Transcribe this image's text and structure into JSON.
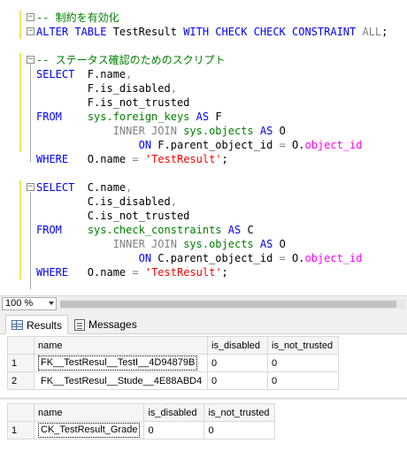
{
  "editor": {
    "lines": [
      [
        {
          "t": "-- 制約を有効化",
          "c": "cm"
        }
      ],
      [
        {
          "t": "ALTER TABLE ",
          "c": "kw"
        },
        {
          "t": "TestResult ",
          "c": "plain"
        },
        {
          "t": "WITH CHECK CHECK CONSTRAINT ",
          "c": "kw"
        },
        {
          "t": "ALL",
          "c": "gr"
        },
        {
          "t": ";",
          "c": "plain"
        }
      ],
      [
        {
          "t": "",
          "c": "plain"
        }
      ],
      [
        {
          "t": "-- ステータス確認のためのスクリプト",
          "c": "cm"
        }
      ],
      [
        {
          "t": "SELECT",
          "c": "kw"
        },
        {
          "t": "  F.name",
          "c": "plain"
        },
        {
          "t": ",",
          "c": "gr"
        }
      ],
      [
        {
          "t": "        F.is_disabled",
          "c": "plain"
        },
        {
          "t": ",",
          "c": "gr"
        }
      ],
      [
        {
          "t": "        F.is_not_trusted",
          "c": "plain"
        }
      ],
      [
        {
          "t": "FROM",
          "c": "kw"
        },
        {
          "t": "    ",
          "c": "plain"
        },
        {
          "t": "sys.foreign_keys",
          "c": "sys"
        },
        {
          "t": " AS ",
          "c": "kw"
        },
        {
          "t": "F",
          "c": "plain"
        }
      ],
      [
        {
          "t": "            ",
          "c": "plain"
        },
        {
          "t": "INNER JOIN",
          "c": "gr"
        },
        {
          "t": " ",
          "c": "plain"
        },
        {
          "t": "sys.objects",
          "c": "sys"
        },
        {
          "t": " AS ",
          "c": "kw"
        },
        {
          "t": "O",
          "c": "plain"
        }
      ],
      [
        {
          "t": "                ",
          "c": "plain"
        },
        {
          "t": "ON ",
          "c": "kw"
        },
        {
          "t": "F.parent_object_id ",
          "c": "plain"
        },
        {
          "t": "=",
          "c": "gr"
        },
        {
          "t": " O.",
          "c": "plain"
        },
        {
          "t": "object_id",
          "c": "fn"
        }
      ],
      [
        {
          "t": "WHERE",
          "c": "kw"
        },
        {
          "t": "   O.name ",
          "c": "plain"
        },
        {
          "t": "=",
          "c": "gr"
        },
        {
          "t": " ",
          "c": "plain"
        },
        {
          "t": "'TestResult'",
          "c": "str"
        },
        {
          "t": ";",
          "c": "plain"
        }
      ],
      [
        {
          "t": "",
          "c": "plain"
        }
      ],
      [
        {
          "t": "SELECT",
          "c": "kw"
        },
        {
          "t": "  C.name",
          "c": "plain"
        },
        {
          "t": ",",
          "c": "gr"
        }
      ],
      [
        {
          "t": "        C.is_disabled",
          "c": "plain"
        },
        {
          "t": ",",
          "c": "gr"
        }
      ],
      [
        {
          "t": "        C.is_not_trusted",
          "c": "plain"
        }
      ],
      [
        {
          "t": "FROM",
          "c": "kw"
        },
        {
          "t": "    ",
          "c": "plain"
        },
        {
          "t": "sys.check_constraints",
          "c": "sys"
        },
        {
          "t": " AS ",
          "c": "kw"
        },
        {
          "t": "C",
          "c": "plain"
        }
      ],
      [
        {
          "t": "            ",
          "c": "plain"
        },
        {
          "t": "INNER JOIN",
          "c": "gr"
        },
        {
          "t": " ",
          "c": "plain"
        },
        {
          "t": "sys.objects",
          "c": "sys"
        },
        {
          "t": " AS ",
          "c": "kw"
        },
        {
          "t": "O",
          "c": "plain"
        }
      ],
      [
        {
          "t": "                ",
          "c": "plain"
        },
        {
          "t": "ON ",
          "c": "kw"
        },
        {
          "t": "C.parent_object_id ",
          "c": "plain"
        },
        {
          "t": "=",
          "c": "gr"
        },
        {
          "t": " O.",
          "c": "plain"
        },
        {
          "t": "object_id",
          "c": "fn"
        }
      ],
      [
        {
          "t": "WHERE",
          "c": "kw"
        },
        {
          "t": "   O.name ",
          "c": "plain"
        },
        {
          "t": "=",
          "c": "gr"
        },
        {
          "t": " ",
          "c": "plain"
        },
        {
          "t": "'TestResult'",
          "c": "str"
        },
        {
          "t": ";",
          "c": "plain"
        }
      ]
    ]
  },
  "zoom": {
    "value": "100 %"
  },
  "tabs": [
    {
      "label": "Results",
      "icon": "results-grid-icon"
    },
    {
      "label": "Messages",
      "icon": "messages-icon"
    }
  ],
  "grid1": {
    "columns": [
      "name",
      "is_disabled",
      "is_not_trusted"
    ],
    "rows": [
      {
        "n": "1",
        "cells": [
          "FK__TestResul__TestI__4D94879B",
          "0",
          "0"
        ]
      },
      {
        "n": "2",
        "cells": [
          "FK__TestResul__Stude__4E88ABD4",
          "0",
          "0"
        ]
      }
    ]
  },
  "grid2": {
    "columns": [
      "name",
      "is_disabled",
      "is_not_trusted"
    ],
    "rows": [
      {
        "n": "1",
        "cells": [
          "CK_TestResult_Grade",
          "0",
          "0"
        ]
      }
    ]
  },
  "colors": {
    "keyword": "#0000ff",
    "comment": "#008000",
    "string": "#ff0000",
    "function": "#ff00ff",
    "operator": "#808080"
  }
}
